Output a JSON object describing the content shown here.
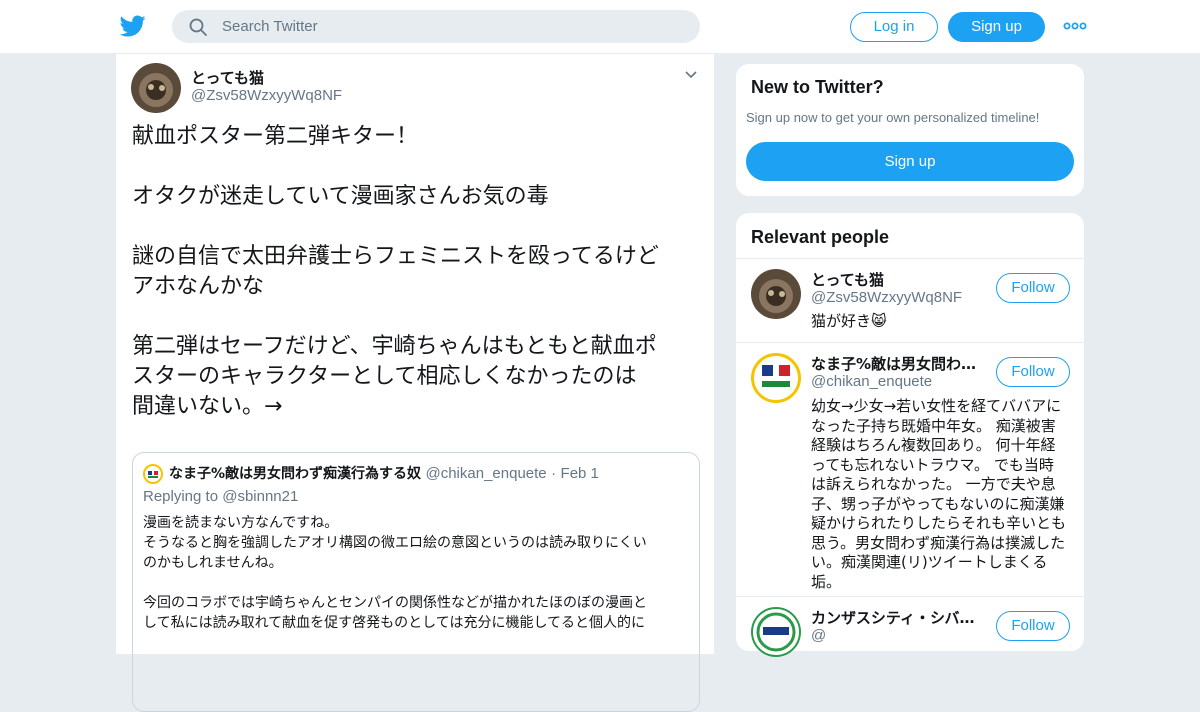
{
  "header": {
    "logo_icon": "twitter-bird-icon",
    "search_placeholder": "Search Twitter",
    "login_label": "Log in",
    "signup_label": "Sign up",
    "more_icon": "more-dots-icon",
    "brand_color": "#1da1f2"
  },
  "tweet": {
    "author_name": "とっても猫",
    "author_handle": "@Zsv58WzxyyWq8NF",
    "text": "献血ポスター第二弾キター！\n\nオタクが迷走していて漫画家さんお気の毒\n\n謎の自信で太田弁護士らフェミニストを殴ってるけど\nアホなんかな\n\n第二弾はセーフだけど、宇崎ちゃんはもともと献血ポ\nスターのキャラクターとして相応しくなかったのは\n間違いない。→",
    "quoted": {
      "author_name": "なま子%敵は男女問わず痴漢行為する奴",
      "author_handle": "@chikan_enquete",
      "separator": "·",
      "date": "Feb 1",
      "replying_prefix": "Replying to",
      "replying_to": "@sbinnn21",
      "text": "漫画を読まない方なんですね。\nそうなると胸を強調したアオリ構図の微エロ絵の意図というのは読み取りにくい\nのかもしれませんね。\n\n今回のコラボでは宇崎ちゃんとセンパイの関係性などが描かれたほのぼの漫画と\nして私には読み取れて献血を促す啓発ものとしては充分に機能してると個人的に"
    }
  },
  "sidebar": {
    "new_card": {
      "title": "New to Twitter?",
      "subtitle": "Sign up now to get your own personalized timeline!",
      "signup_label": "Sign up"
    },
    "relevant": {
      "title": "Relevant people",
      "follow_label": "Follow",
      "people": [
        {
          "name": "とっても猫",
          "handle": "@Zsv58WzxyyWq8NF",
          "bio": "猫が好き😸"
        },
        {
          "name": "なま子%敵は男女問わず痴漢行為する奴",
          "handle": "@chikan_enquete",
          "bio": "幼女→少女→若い女性を経てババアに\nなった子持ち既婚中年女。 痴漢被害\n経験はちろん複数回あり。 何十年経\nっても忘れないトラウマ。 でも当時\nは訴えられなかった。 一方で夫や息\n子、甥っ子がやってもないのに痴漢嫌\n疑かけられたりしたらそれも辛いとも\n思う。男女問わず痴漢行為は撲滅した\nい。痴漢関連(リ)ツイートしまくる\n垢。"
        },
        {
          "name": "カンザスシティ・シバ…",
          "handle": "@",
          "bio": ""
        }
      ]
    }
  }
}
